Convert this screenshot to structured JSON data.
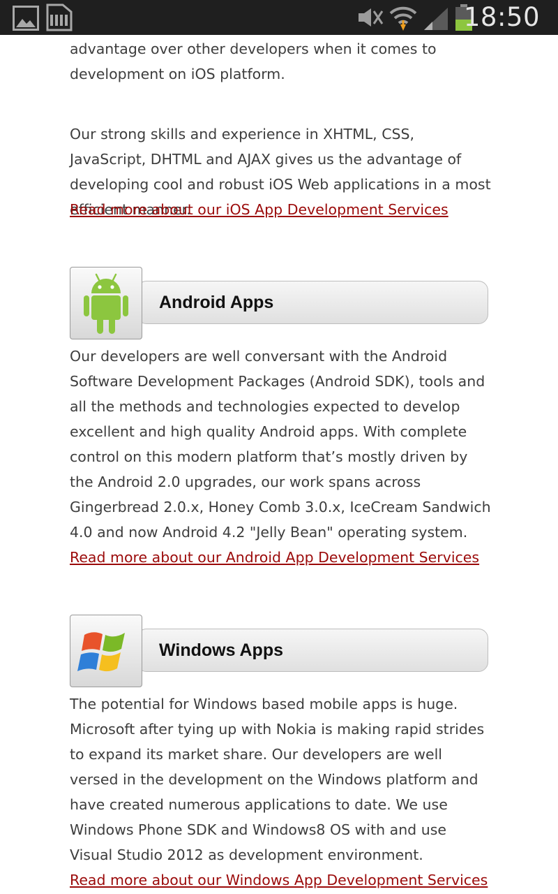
{
  "status_bar": {
    "time": "18:50",
    "icons": [
      "gallery-icon",
      "sd-card-icon",
      "mute-icon",
      "wifi-icon",
      "signal-icon",
      "battery-icon"
    ]
  },
  "intro": {
    "para1": "advantage over other developers when it comes to development on iOS platform.",
    "para2": "Our strong skills and experience in XHTML, CSS, JavaScript, DHTML and AJAX gives us the advantage of developing cool and robust iOS Web applications in a most efficient manner.",
    "link": "Read more about our iOS App Development Services"
  },
  "sections": [
    {
      "title": "Android Apps",
      "icon": "android-robot-icon",
      "body": "Our developers are well conversant with the Android Software Development Packages (Android SDK), tools and all the methods and technologies expected to develop excellent and high quality Android apps. With complete control on this modern platform that’s mostly driven by the Android 2.0 upgrades, our work spans across Gingerbread 2.0.x, Honey Comb 3.0.x, IceCream Sandwich 4.0 and now Android 4.2 \"Jelly Bean\" operating system.",
      "link": "Read more about our Android App Development Services"
    },
    {
      "title": "Windows Apps",
      "icon": "windows-logo-icon",
      "body": "The potential for Windows based mobile apps is huge. Microsoft after tying up with Nokia is making rapid strides to expand its market share. Our developers are well versed in the development on the Windows platform and have created numerous applications to date. We use Windows Phone SDK and Windows8 OS with and use Visual Studio 2012 as development environment.",
      "link": "Read more about our Windows App Development Services"
    }
  ],
  "colors": {
    "link": "#9b0a0a",
    "body_text": "#3d3d3d",
    "status_bar": "#1f1f1f",
    "android_green": "#8cc63f"
  }
}
